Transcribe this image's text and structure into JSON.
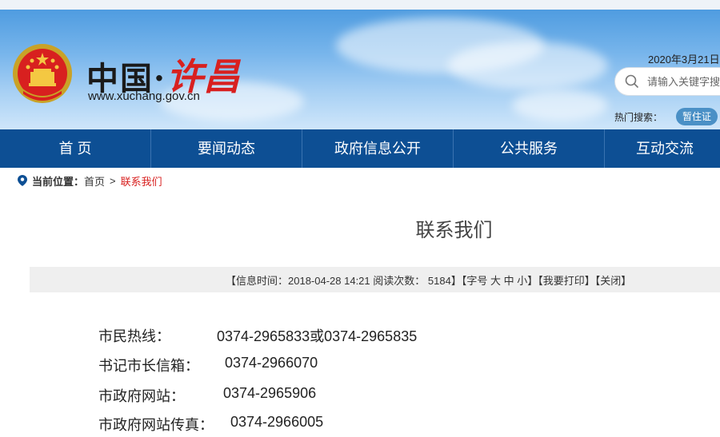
{
  "header": {
    "site_title_cn": "中国·",
    "site_title_city": "许昌",
    "site_url": "www.xuchang.gov.cn",
    "date": "2020年3月21日",
    "search": {
      "placeholder": "请输入关键字搜索"
    },
    "hot_search_label": "热门搜索：",
    "hot_search_tag": "暂住证"
  },
  "nav": {
    "items": [
      "首 页",
      "要闻动态",
      "政府信息公开",
      "公共服务",
      "互动交流"
    ]
  },
  "breadcrumb": {
    "label": "当前位置：",
    "home": "首页",
    "separator": ">",
    "current": "联系我们"
  },
  "article": {
    "title": "联系我们",
    "info": {
      "time_label": "【信息时间：2018-04-28 14:21",
      "views_label": "阅读次数：",
      "views": "5184】",
      "font_size_label": "【字号",
      "font_large": "大",
      "font_medium": "中",
      "font_small": "小】",
      "print": "【我要打印】",
      "close": "【关闭】"
    },
    "contacts": [
      {
        "label": "市民热线：",
        "value": "0374-2965833或0374-2965835"
      },
      {
        "label": "书记市长信箱：",
        "value": "0374-2966070"
      },
      {
        "label": "市政府网站：",
        "value": "0374-2965906"
      },
      {
        "label": "市政府网站传真：",
        "value": "0374-2966005"
      }
    ]
  },
  "colors": {
    "nav_bg": "#0d4f94",
    "accent_red": "#d8201f",
    "info_bar_bg": "#efefef"
  }
}
